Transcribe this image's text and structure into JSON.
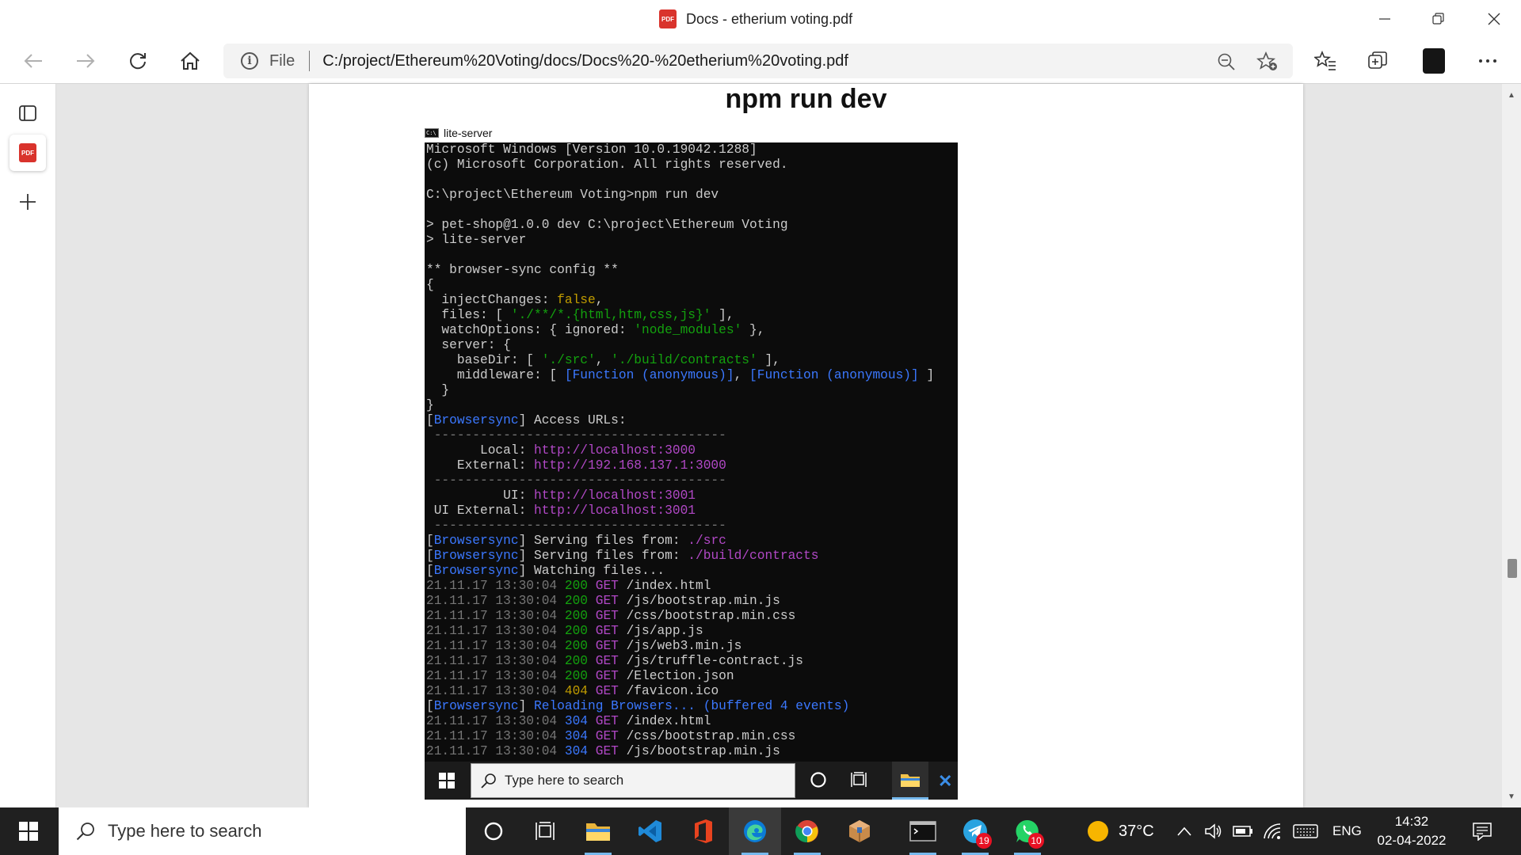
{
  "window": {
    "title": "Docs - etherium voting.pdf",
    "pdf_badge": "PDF"
  },
  "address_bar": {
    "scheme_label": "File",
    "url": "C:/project/Ethereum%20Voting/docs/Docs%20-%20etherium%20voting.pdf"
  },
  "pdf": {
    "heading": "npm run dev",
    "cmd_title": "lite-server",
    "cmd_icon_text": "C:\\",
    "inner_taskbar_search": "Type here to search"
  },
  "terminal_lines": [
    [
      {
        "t": "Microsoft Windows [Version 10.0.19042.1288]",
        "c": "w"
      }
    ],
    [
      {
        "t": "(c) Microsoft Corporation. All rights reserved.",
        "c": "w"
      }
    ],
    [
      {
        "t": "",
        "c": "w"
      }
    ],
    [
      {
        "t": "C:\\project\\Ethereum Voting>npm run dev",
        "c": "w"
      }
    ],
    [
      {
        "t": "",
        "c": "w"
      }
    ],
    [
      {
        "t": "> pet-shop@1.0.0 dev C:\\project\\Ethereum Voting",
        "c": "w"
      }
    ],
    [
      {
        "t": "> lite-server",
        "c": "w"
      }
    ],
    [
      {
        "t": "",
        "c": "w"
      }
    ],
    [
      {
        "t": "** browser-sync config **",
        "c": "w"
      }
    ],
    [
      {
        "t": "{",
        "c": "w"
      }
    ],
    [
      {
        "t": "  injectChanges: ",
        "c": "w"
      },
      {
        "t": "false",
        "c": "y"
      },
      {
        "t": ",",
        "c": "w"
      }
    ],
    [
      {
        "t": "  files: [ ",
        "c": "w"
      },
      {
        "t": "'./**/*.{html,htm,css,js}'",
        "c": "g"
      },
      {
        "t": " ],",
        "c": "w"
      }
    ],
    [
      {
        "t": "  watchOptions: { ignored: ",
        "c": "w"
      },
      {
        "t": "'node_modules'",
        "c": "g"
      },
      {
        "t": " },",
        "c": "w"
      }
    ],
    [
      {
        "t": "  server: {",
        "c": "w"
      }
    ],
    [
      {
        "t": "    baseDir: [ ",
        "c": "w"
      },
      {
        "t": "'./src'",
        "c": "g"
      },
      {
        "t": ", ",
        "c": "w"
      },
      {
        "t": "'./build/contracts'",
        "c": "g"
      },
      {
        "t": " ],",
        "c": "w"
      }
    ],
    [
      {
        "t": "    middleware: [ ",
        "c": "w"
      },
      {
        "t": "[Function (anonymous)]",
        "c": "b"
      },
      {
        "t": ", ",
        "c": "w"
      },
      {
        "t": "[Function (anonymous)]",
        "c": "b"
      },
      {
        "t": " ]",
        "c": "w"
      }
    ],
    [
      {
        "t": "  }",
        "c": "w"
      }
    ],
    [
      {
        "t": "}",
        "c": "w"
      }
    ],
    [
      {
        "t": "[",
        "c": "w"
      },
      {
        "t": "Browsersync",
        "c": "b"
      },
      {
        "t": "] Access URLs:",
        "c": "w"
      }
    ],
    [
      {
        "t": " --------------------------------------",
        "c": "d"
      }
    ],
    [
      {
        "t": "       Local: ",
        "c": "w"
      },
      {
        "t": "http://localhost:3000",
        "c": "m"
      }
    ],
    [
      {
        "t": "    External: ",
        "c": "w"
      },
      {
        "t": "http://192.168.137.1:3000",
        "c": "m"
      }
    ],
    [
      {
        "t": " --------------------------------------",
        "c": "d"
      }
    ],
    [
      {
        "t": "          UI: ",
        "c": "w"
      },
      {
        "t": "http://localhost:3001",
        "c": "m"
      }
    ],
    [
      {
        "t": " UI External: ",
        "c": "w"
      },
      {
        "t": "http://localhost:3001",
        "c": "m"
      }
    ],
    [
      {
        "t": " --------------------------------------",
        "c": "d"
      }
    ],
    [
      {
        "t": "[",
        "c": "w"
      },
      {
        "t": "Browsersync",
        "c": "b"
      },
      {
        "t": "] Serving files from: ",
        "c": "w"
      },
      {
        "t": "./src",
        "c": "m"
      }
    ],
    [
      {
        "t": "[",
        "c": "w"
      },
      {
        "t": "Browsersync",
        "c": "b"
      },
      {
        "t": "] Serving files from: ",
        "c": "w"
      },
      {
        "t": "./build/contracts",
        "c": "m"
      }
    ],
    [
      {
        "t": "[",
        "c": "w"
      },
      {
        "t": "Browsersync",
        "c": "b"
      },
      {
        "t": "] Watching files...",
        "c": "w"
      }
    ],
    [
      {
        "t": "21.11.17 13:30:04 ",
        "c": "d"
      },
      {
        "t": "200",
        "c": "g"
      },
      {
        "t": " GET ",
        "c": "m"
      },
      {
        "t": "/index.html",
        "c": "w"
      }
    ],
    [
      {
        "t": "21.11.17 13:30:04 ",
        "c": "d"
      },
      {
        "t": "200",
        "c": "g"
      },
      {
        "t": " GET ",
        "c": "m"
      },
      {
        "t": "/js/bootstrap.min.js",
        "c": "w"
      }
    ],
    [
      {
        "t": "21.11.17 13:30:04 ",
        "c": "d"
      },
      {
        "t": "200",
        "c": "g"
      },
      {
        "t": " GET ",
        "c": "m"
      },
      {
        "t": "/css/bootstrap.min.css",
        "c": "w"
      }
    ],
    [
      {
        "t": "21.11.17 13:30:04 ",
        "c": "d"
      },
      {
        "t": "200",
        "c": "g"
      },
      {
        "t": " GET ",
        "c": "m"
      },
      {
        "t": "/js/app.js",
        "c": "w"
      }
    ],
    [
      {
        "t": "21.11.17 13:30:04 ",
        "c": "d"
      },
      {
        "t": "200",
        "c": "g"
      },
      {
        "t": " GET ",
        "c": "m"
      },
      {
        "t": "/js/web3.min.js",
        "c": "w"
      }
    ],
    [
      {
        "t": "21.11.17 13:30:04 ",
        "c": "d"
      },
      {
        "t": "200",
        "c": "g"
      },
      {
        "t": " GET ",
        "c": "m"
      },
      {
        "t": "/js/truffle-contract.js",
        "c": "w"
      }
    ],
    [
      {
        "t": "21.11.17 13:30:04 ",
        "c": "d"
      },
      {
        "t": "200",
        "c": "g"
      },
      {
        "t": " GET ",
        "c": "m"
      },
      {
        "t": "/Election.json",
        "c": "w"
      }
    ],
    [
      {
        "t": "21.11.17 13:30:04 ",
        "c": "d"
      },
      {
        "t": "404",
        "c": "y"
      },
      {
        "t": " GET ",
        "c": "m"
      },
      {
        "t": "/favicon.ico",
        "c": "w"
      }
    ],
    [
      {
        "t": "[",
        "c": "w"
      },
      {
        "t": "Browsersync",
        "c": "b"
      },
      {
        "t": "] ",
        "c": "w"
      },
      {
        "t": "Reloading Browsers... (buffered 4 events)",
        "c": "b"
      }
    ],
    [
      {
        "t": "21.11.17 13:30:04 ",
        "c": "d"
      },
      {
        "t": "304",
        "c": "b"
      },
      {
        "t": " GET ",
        "c": "m"
      },
      {
        "t": "/index.html",
        "c": "w"
      }
    ],
    [
      {
        "t": "21.11.17 13:30:04 ",
        "c": "d"
      },
      {
        "t": "304",
        "c": "b"
      },
      {
        "t": " GET ",
        "c": "m"
      },
      {
        "t": "/css/bootstrap.min.css",
        "c": "w"
      }
    ],
    [
      {
        "t": "21.11.17 13:30:04 ",
        "c": "d"
      },
      {
        "t": "304",
        "c": "b"
      },
      {
        "t": " GET ",
        "c": "m"
      },
      {
        "t": "/js/bootstrap.min.js",
        "c": "w"
      }
    ]
  ],
  "taskbar": {
    "search_placeholder": "Type here to search",
    "apps": [
      {
        "name": "cortana",
        "icon": "circle-icon"
      },
      {
        "name": "task-view",
        "icon": "task-view-icon"
      },
      {
        "name": "file-explorer",
        "icon": "folder-icon"
      },
      {
        "name": "vscode",
        "icon": "vscode-icon"
      },
      {
        "name": "office",
        "icon": "office-icon"
      },
      {
        "name": "edge",
        "icon": "edge-icon"
      },
      {
        "name": "chrome",
        "icon": "chrome-icon"
      },
      {
        "name": "package",
        "icon": "box-icon"
      },
      {
        "name": "terminal",
        "icon": "terminal-icon"
      },
      {
        "name": "telegram",
        "icon": "telegram-icon",
        "badge": "19"
      },
      {
        "name": "whatsapp",
        "icon": "whatsapp-icon",
        "badge": "10"
      }
    ],
    "weather": "37°C",
    "language": "ENG",
    "time": "14:32",
    "date": "02-04-2022"
  },
  "colors": {
    "terminal_bg": "#0c0c0c",
    "taskbar_bg": "#202020",
    "edge_blue": "#0c7bd6",
    "pdf_red": "#d9332c"
  }
}
